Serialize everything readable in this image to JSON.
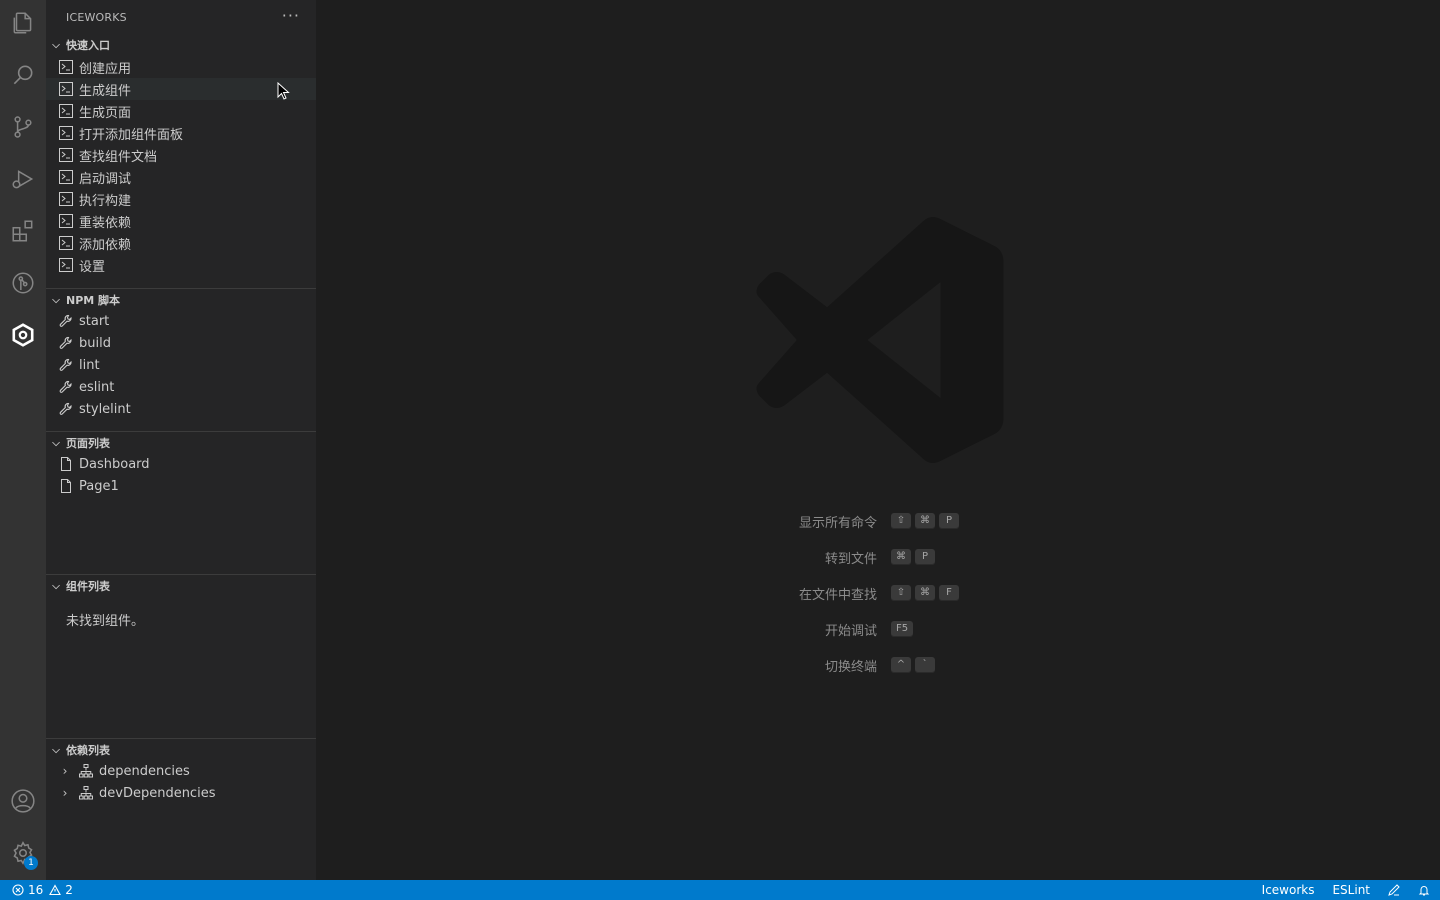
{
  "sidebar": {
    "title": "ICEWORKS",
    "more_label": "···",
    "quick_entry": {
      "header": "快速入口",
      "items": [
        "创建应用",
        "生成组件",
        "生成页面",
        "打开添加组件面板",
        "查找组件文档",
        "启动调试",
        "执行构建",
        "重装依赖",
        "添加依赖",
        "设置"
      ]
    },
    "npm_scripts": {
      "header": "NPM 脚本",
      "items": [
        "start",
        "build",
        "lint",
        "eslint",
        "stylelint"
      ]
    },
    "pages": {
      "header": "页面列表",
      "items": [
        "Dashboard",
        "Page1"
      ]
    },
    "components": {
      "header": "组件列表",
      "empty": "未找到组件。"
    },
    "dependencies": {
      "header": "依赖列表",
      "items": [
        "dependencies",
        "devDependencies"
      ]
    }
  },
  "activity_bar": {
    "icons": [
      "files-icon",
      "search-icon",
      "source-control-icon",
      "run-debug-icon",
      "extensions-icon",
      "git-graph-icon",
      "iceworks-icon"
    ],
    "bottom_icons": [
      "account-icon",
      "settings-gear-icon"
    ],
    "settings_badge": "1"
  },
  "editor": {
    "shortcuts": [
      {
        "label": "显示所有命令",
        "keys": [
          "⇧",
          "⌘",
          "P"
        ]
      },
      {
        "label": "转到文件",
        "keys": [
          "⌘",
          "P"
        ]
      },
      {
        "label": "在文件中查找",
        "keys": [
          "⇧",
          "⌘",
          "F"
        ]
      },
      {
        "label": "开始调试",
        "keys": [
          "F5"
        ]
      },
      {
        "label": "切换终端",
        "keys": [
          "^",
          "`"
        ]
      }
    ]
  },
  "status_bar": {
    "errors": "16",
    "warnings": "2",
    "right_items": [
      "Iceworks",
      "ESLint"
    ],
    "colors": {
      "background": "#007acc"
    }
  }
}
